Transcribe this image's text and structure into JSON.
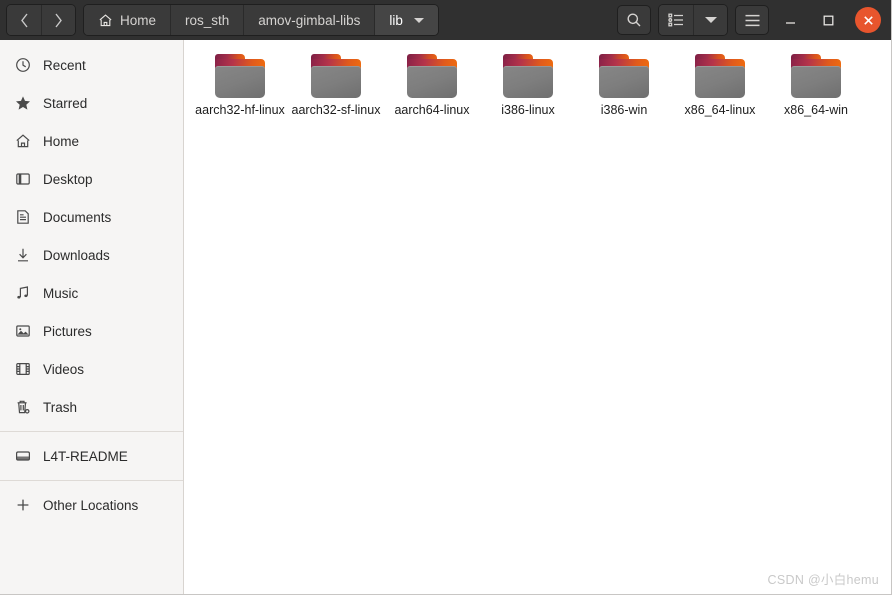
{
  "window": {
    "titlebar_bg": "#303030",
    "accent": "#e8552d"
  },
  "header": {
    "nav": {
      "back_label": "‹",
      "forward_label": "›",
      "back_name": "back-button",
      "forward_name": "forward-button"
    },
    "breadcrumbs": [
      {
        "label": "Home",
        "icon": "home-icon",
        "active": false
      },
      {
        "label": "ros_sth",
        "icon": "",
        "active": false
      },
      {
        "label": "amov-gimbal-libs",
        "icon": "",
        "active": false
      },
      {
        "label": "lib",
        "icon": "",
        "active": true
      }
    ],
    "buttons": {
      "search": "search-icon",
      "view_list": "list-view-icon",
      "view_dropdown": "chevron-down-icon",
      "menu": "hamburger-menu-icon"
    },
    "window_controls": {
      "minimize": "–",
      "maximize": "□",
      "close": "✕"
    }
  },
  "sidebar": {
    "groups": [
      {
        "items": [
          {
            "label": "Recent",
            "icon": "clock-icon"
          },
          {
            "label": "Starred",
            "icon": "star-icon"
          },
          {
            "label": "Home",
            "icon": "home-icon"
          },
          {
            "label": "Desktop",
            "icon": "desktop-icon"
          },
          {
            "label": "Documents",
            "icon": "document-icon"
          },
          {
            "label": "Downloads",
            "icon": "download-icon"
          },
          {
            "label": "Music",
            "icon": "music-icon"
          },
          {
            "label": "Pictures",
            "icon": "picture-icon"
          },
          {
            "label": "Videos",
            "icon": "video-icon"
          },
          {
            "label": "Trash",
            "icon": "trash-icon"
          }
        ]
      },
      {
        "items": [
          {
            "label": "L4T-README",
            "icon": "drive-icon"
          }
        ]
      },
      {
        "items": [
          {
            "label": "Other Locations",
            "icon": "plus-icon"
          }
        ]
      }
    ]
  },
  "content": {
    "files": [
      {
        "name": "aarch32-hf-linux",
        "type": "folder"
      },
      {
        "name": "aarch32-sf-linux",
        "type": "folder"
      },
      {
        "name": "aarch64-linux",
        "type": "folder"
      },
      {
        "name": "i386-linux",
        "type": "folder"
      },
      {
        "name": "i386-win",
        "type": "folder"
      },
      {
        "name": "x86_64-linux",
        "type": "folder"
      },
      {
        "name": "x86_64-win",
        "type": "folder"
      }
    ]
  },
  "watermark": {
    "text": "CSDN @小白hemu"
  }
}
